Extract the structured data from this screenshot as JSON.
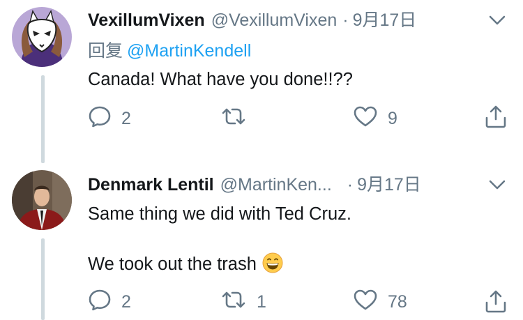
{
  "tweets": [
    {
      "name": "VexillumVixen",
      "handle": "@VexillumVixen",
      "separator": "·",
      "date": "9月17日",
      "reply_prefix": "回复",
      "reply_mention": "@MartinKendell",
      "lines": [
        "Canada! What have you done!!??"
      ],
      "reply_count": "2",
      "retweet_count": "",
      "like_count": "9"
    },
    {
      "name": "Denmark Lentil",
      "handle": "@MartinKen...",
      "separator": "·",
      "date": "9月17日",
      "lines": [
        "Same thing we did with Ted Cruz.",
        "We took out the trash"
      ],
      "emoji": "grinning-face",
      "reply_count": "2",
      "retweet_count": "1",
      "like_count": "78"
    }
  ],
  "icons": {
    "reply": "speech-bubble-icon",
    "retweet": "retweet-icon",
    "like": "heart-icon",
    "share": "share-icon",
    "menu": "chevron-down-icon"
  },
  "colors": {
    "text": "#14171a",
    "secondary": "#657786",
    "link": "#1da1f2",
    "thread_line": "#cfd9de"
  }
}
